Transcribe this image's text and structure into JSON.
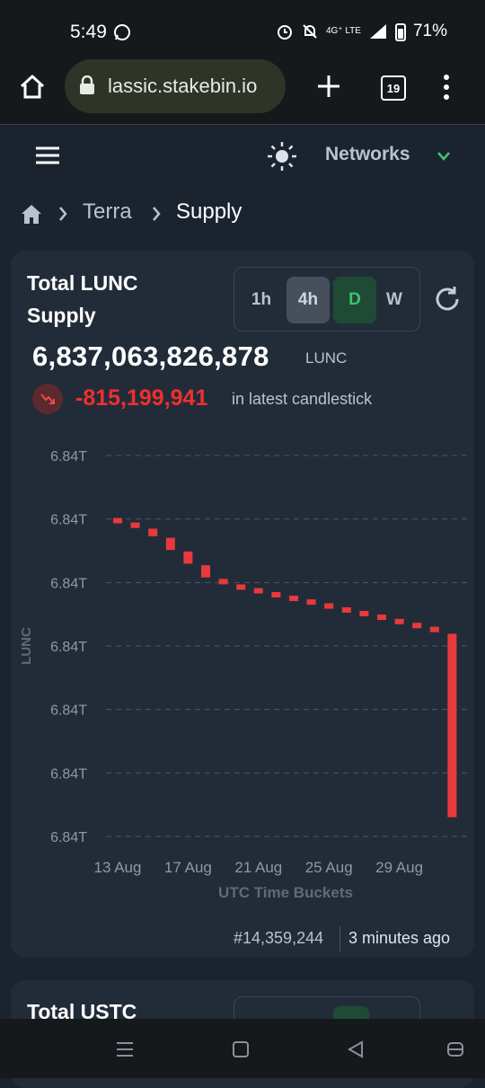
{
  "status": {
    "time": "5:49",
    "network": "4G⁺ LTE",
    "battery": "71%",
    "icons": [
      "whatsapp-icon",
      "alarm-icon",
      "mute-icon",
      "signal-icon",
      "battery-icon"
    ]
  },
  "browser": {
    "url": "lassic.stakebin.io",
    "tab_count": "19"
  },
  "header": {
    "networks_label": "Networks"
  },
  "breadcrumb": {
    "items": [
      "Terra",
      "Supply"
    ]
  },
  "card": {
    "title": "Total LUNC Supply",
    "timeframes": [
      "1h",
      "4h",
      "D",
      "W"
    ],
    "selected_timeframe": "D",
    "supply_value": "6,837,063,826,878",
    "supply_unit": "LUNC",
    "delta_value": "-815,199,941",
    "delta_text": "in latest candlestick",
    "block_number": "#14,359,244",
    "updated_ago": "3 minutes ago"
  },
  "card2": {
    "title": "Total USTC"
  },
  "colors": {
    "background": "#1b232e",
    "card": "#222c38",
    "candle_down": "#e8393c",
    "accent_green": "#3ec46d",
    "negative": "#ef2f2f"
  },
  "chart_data": {
    "type": "candlestick",
    "ylabel": "LUNC",
    "xlabel": "UTC Time Buckets",
    "y_tick_labels": [
      "6.84T",
      "6.84T",
      "6.84T",
      "6.84T",
      "6.84T",
      "6.84T",
      "6.84T"
    ],
    "x_tick_labels": [
      "13 Aug",
      "17 Aug",
      "21 Aug",
      "25 Aug",
      "29 Aug"
    ],
    "ylim": [
      6837.0,
      6838.25
    ],
    "grid": true,
    "candles": [
      {
        "x": "2024-08-13",
        "open": 6838.045,
        "close": 6838.035
      },
      {
        "x": "2024-08-14",
        "open": 6838.03,
        "close": 6838.015
      },
      {
        "x": "2024-08-15",
        "open": 6838.01,
        "close": 6837.985
      },
      {
        "x": "2024-08-16",
        "open": 6837.98,
        "close": 6837.94
      },
      {
        "x": "2024-08-17",
        "open": 6837.935,
        "close": 6837.895
      },
      {
        "x": "2024-08-18",
        "open": 6837.89,
        "close": 6837.85
      },
      {
        "x": "2024-08-19",
        "open": 6837.845,
        "close": 6837.83
      },
      {
        "x": "2024-08-20",
        "open": 6837.827,
        "close": 6837.817
      },
      {
        "x": "2024-08-21",
        "open": 6837.815,
        "close": 6837.805
      },
      {
        "x": "2024-08-22",
        "open": 6837.802,
        "close": 6837.792
      },
      {
        "x": "2024-08-23",
        "open": 6837.79,
        "close": 6837.78
      },
      {
        "x": "2024-08-24",
        "open": 6837.778,
        "close": 6837.768
      },
      {
        "x": "2024-08-25",
        "open": 6837.765,
        "close": 6837.755
      },
      {
        "x": "2024-08-26",
        "open": 6837.752,
        "close": 6837.742
      },
      {
        "x": "2024-08-27",
        "open": 6837.74,
        "close": 6837.73
      },
      {
        "x": "2024-08-28",
        "open": 6837.728,
        "close": 6837.718
      },
      {
        "x": "2024-08-29",
        "open": 6837.714,
        "close": 6837.704
      },
      {
        "x": "2024-08-30",
        "open": 6837.701,
        "close": 6837.691
      },
      {
        "x": "2024-08-31",
        "open": 6837.688,
        "close": 6837.672
      },
      {
        "x": "2024-09-01",
        "open": 6837.665,
        "close": 6837.063
      }
    ]
  }
}
